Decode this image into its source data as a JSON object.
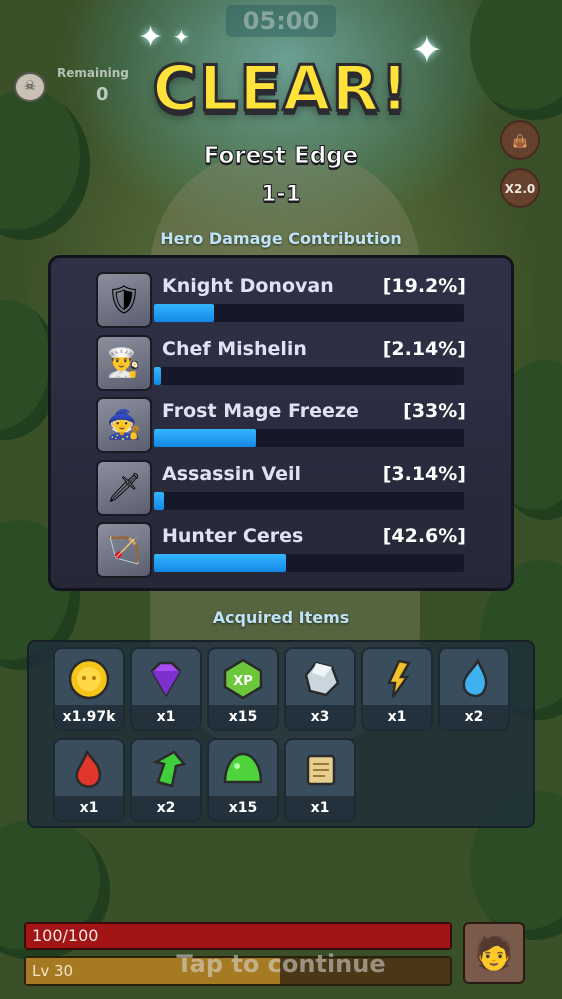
{
  "header": {
    "timer": "05:00",
    "remaining_label": "Remaining",
    "remaining_count": "0",
    "speed_button": "X2.0"
  },
  "result": {
    "title": "CLEAR!",
    "stage_name": "Forest Edge",
    "stage_number": "1-1"
  },
  "damage": {
    "title": "Hero Damage Contribution",
    "heroes": [
      {
        "name": "Knight Donovan",
        "percent_text": "[19.2%]",
        "fraction": 0.192,
        "icon": "knight-portrait"
      },
      {
        "name": "Chef Mishelin",
        "percent_text": "[2.14%]",
        "fraction": 0.0214,
        "icon": "chef-portrait"
      },
      {
        "name": "Frost Mage Freeze",
        "percent_text": "[33%]",
        "fraction": 0.33,
        "icon": "mage-portrait"
      },
      {
        "name": "Assassin Veil",
        "percent_text": "[3.14%]",
        "fraction": 0.0314,
        "icon": "assassin-portrait"
      },
      {
        "name": "Hunter Ceres",
        "percent_text": "[42.6%]",
        "fraction": 0.426,
        "icon": "hunter-portrait"
      }
    ]
  },
  "items": {
    "title": "Acquired Items",
    "list": [
      {
        "icon": "gold-coin-icon",
        "qty": "x1.97k",
        "color": "#f5c518"
      },
      {
        "icon": "purple-gem-icon",
        "qty": "x1",
        "color": "#a64df0"
      },
      {
        "icon": "xp-badge-icon",
        "qty": "x15",
        "color": "#6cc83a"
      },
      {
        "icon": "silver-ore-icon",
        "qty": "x3",
        "color": "#c9d6de"
      },
      {
        "icon": "lightning-shard-icon",
        "qty": "x1",
        "color": "#f3c22b"
      },
      {
        "icon": "blue-crystal-icon",
        "qty": "x2",
        "color": "#3fb1ee"
      },
      {
        "icon": "red-crystal-icon",
        "qty": "x1",
        "color": "#e2352b"
      },
      {
        "icon": "green-arrow-shard-icon",
        "qty": "x2",
        "color": "#3fcf3b"
      },
      {
        "icon": "green-slime-icon",
        "qty": "x15",
        "color": "#4ed43a"
      },
      {
        "icon": "scroll-icon",
        "qty": "x1",
        "color": "#e9cf8f"
      }
    ]
  },
  "footer": {
    "hp_text": "100/100",
    "hp_fraction": 1.0,
    "level_text": "Lv 30",
    "xp_fraction": 0.6,
    "tap_text": "Tap to continue"
  }
}
